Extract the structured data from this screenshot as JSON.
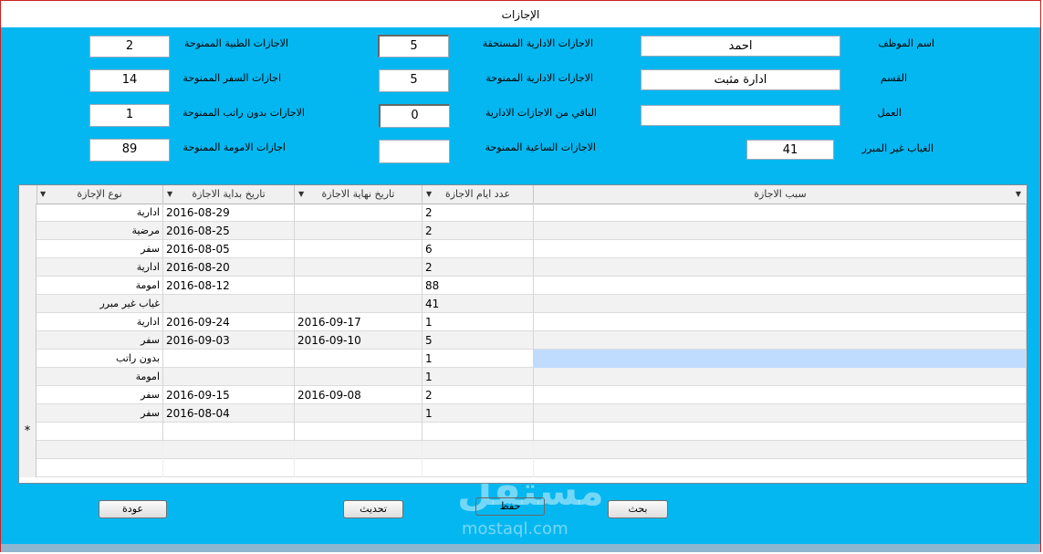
{
  "window": {
    "title": "الإجازات"
  },
  "form": {
    "employee_name_label": "اسم الموظف",
    "employee_name": "احمد",
    "department_label": "القسم",
    "department": "ادارة مثبت",
    "job_label": "العمل",
    "job": "",
    "unjustified_absence_label": "الغياب غير المبرر",
    "unjustified_absence": "41",
    "admin_due_label": "الاجازات الادارية المستحقة",
    "admin_due": "5",
    "admin_granted_label": "الاجازات الادارية  الممنوحة",
    "admin_granted": "5",
    "admin_remaining_label": "الباقي من الاجازات الادارية",
    "admin_remaining": "0",
    "hourly_granted_label": "الاجازات الساعية الممنوحة",
    "hourly_granted": "",
    "medical_granted_label": "الاجازات الطبية الممنوحة",
    "medical_granted": "2",
    "travel_granted_label": "اجازات السفر الممنوحة",
    "travel_granted": "14",
    "unpaid_granted_label": "الاجازات بدون راتب الممنوحة",
    "unpaid_granted": "1",
    "maternity_granted_label": "اجازات الامومة الممنوحة",
    "maternity_granted": "89"
  },
  "table": {
    "columns": [
      "سبب الاجازة",
      "عدد ايام الاجازة",
      "تاريخ نهاية الاجازة",
      "تاريخ بداية الاجازة",
      "نوع الإجازة"
    ],
    "rows": [
      {
        "reason": "",
        "days": "2",
        "end": "",
        "start": "2016-08-29",
        "type": "ادارية"
      },
      {
        "reason": "",
        "days": "2",
        "end": "",
        "start": "2016-08-25",
        "type": "مرضية"
      },
      {
        "reason": "",
        "days": "6",
        "end": "",
        "start": "2016-08-05",
        "type": "سفر"
      },
      {
        "reason": "",
        "days": "2",
        "end": "",
        "start": "2016-08-20",
        "type": "ادارية"
      },
      {
        "reason": "",
        "days": "88",
        "end": "",
        "start": "2016-08-12",
        "type": "امومة"
      },
      {
        "reason": "",
        "days": "41",
        "end": "",
        "start": "",
        "type": "غياب غير مبرر"
      },
      {
        "reason": "",
        "days": "1",
        "end": "2016-09-17",
        "start": "2016-09-24",
        "type": "ادارية"
      },
      {
        "reason": "",
        "days": "5",
        "end": "2016-09-10",
        "start": "2016-09-03",
        "type": "سفر"
      },
      {
        "reason": "",
        "days": "1",
        "end": "",
        "start": "",
        "type": "بدون راتب"
      },
      {
        "reason": "",
        "days": "1",
        "end": "",
        "start": "",
        "type": "امومة"
      },
      {
        "reason": "",
        "days": "2",
        "end": "2016-09-08",
        "start": "2016-09-15",
        "type": "سفر"
      },
      {
        "reason": "",
        "days": "1",
        "end": "",
        "start": "2016-08-04",
        "type": "سفر"
      }
    ],
    "new_row_marker": "*"
  },
  "buttons": {
    "back": "عودة",
    "refresh": "تحديث",
    "save": "حفظ",
    "search": "بحث"
  },
  "watermark": {
    "brand": "مستقل",
    "site": "mostaql.com"
  },
  "colors": {
    "background": "#05b7f0",
    "selection": "#bfdcff"
  }
}
